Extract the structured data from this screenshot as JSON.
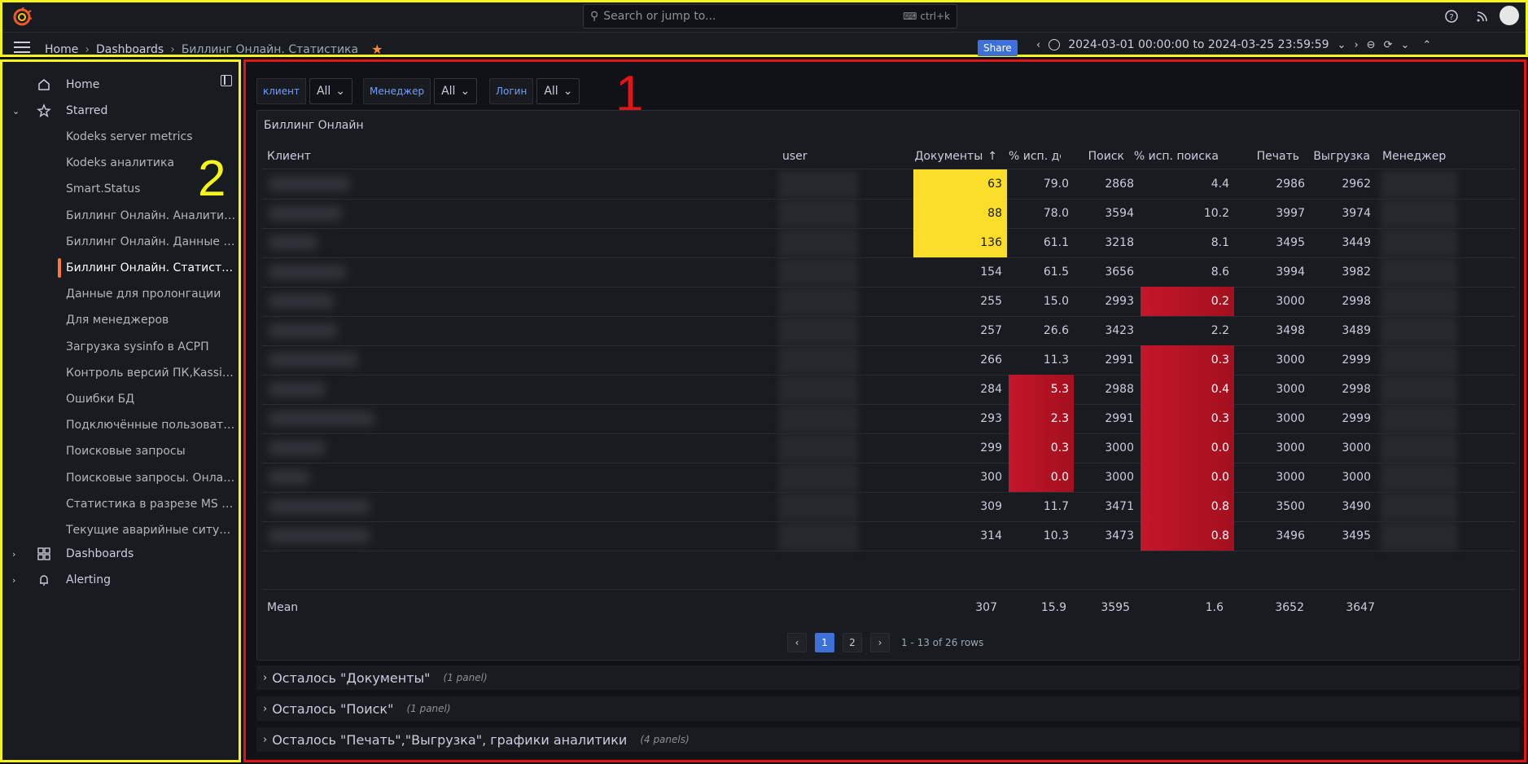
{
  "header": {
    "search_placeholder": "Search or jump to...",
    "search_shortcut": "ctrl+k",
    "breadcrumbs": [
      "Home",
      "Dashboards",
      "Биллинг Онлайн. Статистика"
    ],
    "share_label": "Share",
    "time_range": "2024-03-01 00:00:00 to 2024-03-25 23:59:59"
  },
  "sidebar": {
    "home": "Home",
    "starred": "Starred",
    "starred_items": [
      "Kodeks server metrics",
      "Kodeks аналитика",
      "Smart.Status",
      "Биллинг Онлайн. Аналитика",
      "Биллинг Онлайн. Данные д...",
      "Биллинг Онлайн. Статистика",
      "Данные для пролонгации",
      "Для менеджеров",
      "Загрузка sysinfo в АСРП",
      "Контроль версий ПК,Kassis...",
      "Ошибки БД",
      "Подключённые пользовате...",
      "Поисковые запросы",
      "Поисковые запросы. Онлайн.",
      "Статистика в разрезе MS A...",
      "Текущие аварийные ситуац..."
    ],
    "active_index": 5,
    "dashboards": "Dashboards",
    "alerting": "Alerting"
  },
  "annotations": {
    "one": "1",
    "two": "2"
  },
  "variables": [
    {
      "label": "клиент",
      "value": "All"
    },
    {
      "label": "Менеджер",
      "value": "All"
    },
    {
      "label": "Логин",
      "value": "All"
    }
  ],
  "panel": {
    "title": "Биллинг Онлайн",
    "columns": [
      "Клиент",
      "user",
      "Документы",
      "% исп. дс",
      "Поиск",
      "% исп. поиска",
      "Печать",
      "Выгрузка",
      "Менеджер"
    ],
    "sort_indicator": "↑",
    "rows": [
      {
        "docs": "63",
        "pct_docs": "79.0",
        "search": "2868",
        "pct_search": "4.4",
        "print": "2986",
        "export": "2962",
        "docs_color": "yellow",
        "pd_color": "",
        "ps_color": ""
      },
      {
        "docs": "88",
        "pct_docs": "78.0",
        "search": "3594",
        "pct_search": "10.2",
        "print": "3997",
        "export": "3974",
        "docs_color": "yellow",
        "pd_color": "",
        "ps_color": ""
      },
      {
        "docs": "136",
        "pct_docs": "61.1",
        "search": "3218",
        "pct_search": "8.1",
        "print": "3495",
        "export": "3449",
        "docs_color": "yellow",
        "pd_color": "",
        "ps_color": ""
      },
      {
        "docs": "154",
        "pct_docs": "61.5",
        "search": "3656",
        "pct_search": "8.6",
        "print": "3994",
        "export": "3982",
        "docs_color": "",
        "pd_color": "",
        "ps_color": ""
      },
      {
        "docs": "255",
        "pct_docs": "15.0",
        "search": "2993",
        "pct_search": "0.2",
        "print": "3000",
        "export": "2998",
        "docs_color": "",
        "pd_color": "",
        "ps_color": "red"
      },
      {
        "docs": "257",
        "pct_docs": "26.6",
        "search": "3423",
        "pct_search": "2.2",
        "print": "3498",
        "export": "3489",
        "docs_color": "",
        "pd_color": "",
        "ps_color": ""
      },
      {
        "docs": "266",
        "pct_docs": "11.3",
        "search": "2991",
        "pct_search": "0.3",
        "print": "3000",
        "export": "2999",
        "docs_color": "",
        "pd_color": "",
        "ps_color": "red"
      },
      {
        "docs": "284",
        "pct_docs": "5.3",
        "search": "2988",
        "pct_search": "0.4",
        "print": "3000",
        "export": "2998",
        "docs_color": "",
        "pd_color": "red",
        "ps_color": "red"
      },
      {
        "docs": "293",
        "pct_docs": "2.3",
        "search": "2991",
        "pct_search": "0.3",
        "print": "3000",
        "export": "2999",
        "docs_color": "",
        "pd_color": "red",
        "ps_color": "red"
      },
      {
        "docs": "299",
        "pct_docs": "0.3",
        "search": "3000",
        "pct_search": "0.0",
        "print": "3000",
        "export": "3000",
        "docs_color": "",
        "pd_color": "red",
        "ps_color": "red"
      },
      {
        "docs": "300",
        "pct_docs": "0.0",
        "search": "3000",
        "pct_search": "0.0",
        "print": "3000",
        "export": "3000",
        "docs_color": "",
        "pd_color": "red",
        "ps_color": "red"
      },
      {
        "docs": "309",
        "pct_docs": "11.7",
        "search": "3471",
        "pct_search": "0.8",
        "print": "3500",
        "export": "3490",
        "docs_color": "",
        "pd_color": "",
        "ps_color": "red"
      },
      {
        "docs": "314",
        "pct_docs": "10.3",
        "search": "3473",
        "pct_search": "0.8",
        "print": "3496",
        "export": "3495",
        "docs_color": "",
        "pd_color": "",
        "ps_color": "red"
      }
    ],
    "footer": {
      "label": "Mean",
      "docs": "307",
      "pct_docs": "15.9",
      "search": "3595",
      "pct_search": "1.6",
      "print": "3652",
      "export": "3647"
    },
    "pagination": {
      "prev": "‹",
      "pages": [
        "1",
        "2"
      ],
      "next": "›",
      "info": "1 - 13 of 26 rows"
    }
  },
  "rows_collapsed": [
    {
      "title": "Осталось \"Документы\"",
      "count": "(1 panel)"
    },
    {
      "title": "Осталось \"Поиск\"",
      "count": "(1 panel)"
    },
    {
      "title": "Осталось \"Печать\",\"Выгрузка\", графики аналитики",
      "count": "(4 panels)"
    }
  ]
}
